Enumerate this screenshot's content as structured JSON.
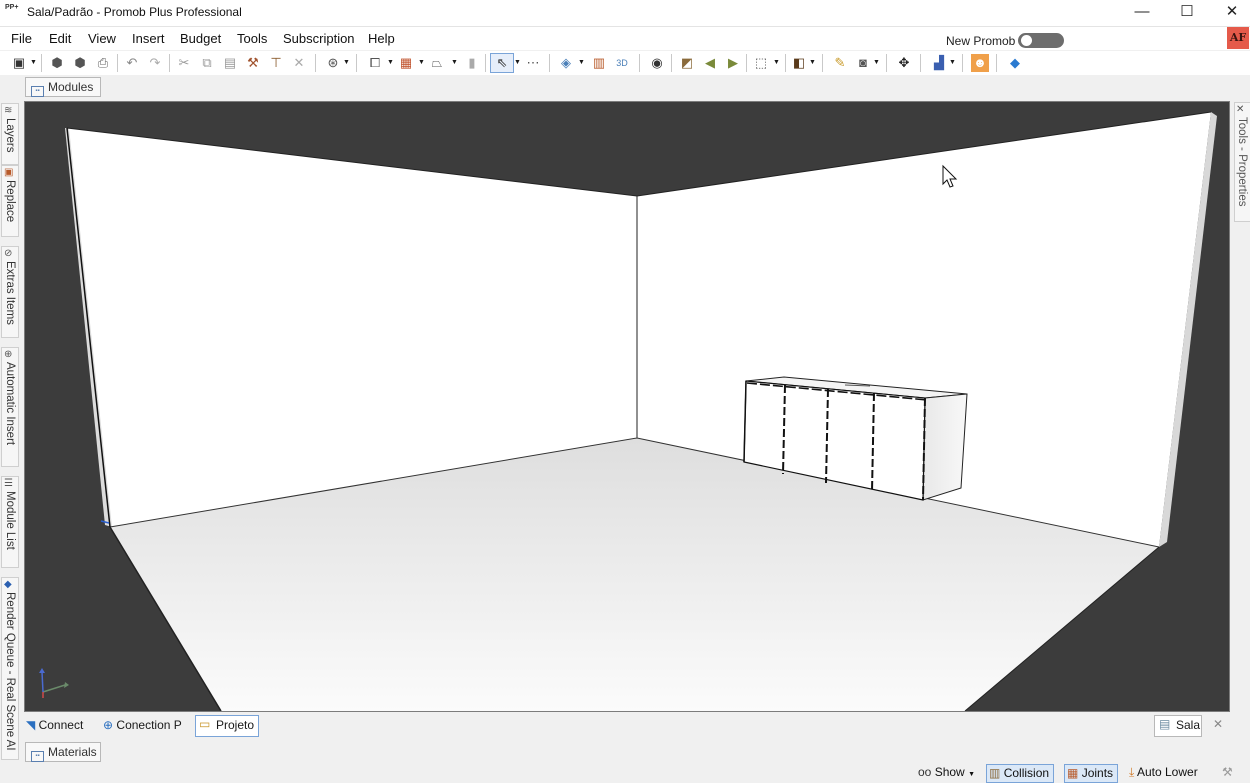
{
  "window": {
    "title": "Sala/Padrão - Promob Plus Professional",
    "app_icon_text": "PP+",
    "minimize_glyph": "—",
    "maximize_glyph": "☐",
    "close_glyph": "✕"
  },
  "menu": {
    "items": [
      "File",
      "Edit",
      "View",
      "Insert",
      "Budget",
      "Tools",
      "Subscription",
      "Help"
    ],
    "new_promob_label": "New Promob",
    "new_promob_on": false,
    "user_initials": "AF"
  },
  "toolbar": {
    "icons": [
      "save-icon",
      "open-icon",
      "cloud-icon",
      "print-icon",
      "undo-icon",
      "redo-icon",
      "cut-icon",
      "copy-icon",
      "paste-icon",
      "hammer-icon",
      "paint-roller-icon",
      "delete-icon",
      "globe-icon",
      "module-icon",
      "wall-icon",
      "shape-icon",
      "column-icon",
      "pointer-icon",
      "dimension-icon",
      "layers-icon",
      "measure-icon",
      "3d-icon",
      "eye-icon",
      "camera-views-icon",
      "arrow-left-icon",
      "arrow-right-icon",
      "box-view-icon",
      "cube-icon",
      "light-icon",
      "photo-icon",
      "move-icon",
      "color-palette-icon",
      "person-icon",
      "chat-icon"
    ]
  },
  "tabs": {
    "modules": "Modules",
    "materials": "Materials"
  },
  "left_dock": [
    "Layers",
    "Replace",
    "Extras Items",
    "Automatic Insert",
    "Module List",
    "Render Queue - Real Scene AI"
  ],
  "right_dock": [
    "Tools - Properties"
  ],
  "bottom_tabs": {
    "connect": "Connect",
    "conection_p": "Conection P",
    "projeto": "Projeto",
    "sala": "Sala"
  },
  "status": {
    "show": "Show",
    "collision": "Collision",
    "joints": "Joints",
    "auto_lower": "Auto Lower"
  },
  "colors": {
    "viewport_bg": "#3c3c3c",
    "wall": "#ffffff",
    "accent": "#1e6fd0",
    "avatar": "#e55a4a"
  }
}
